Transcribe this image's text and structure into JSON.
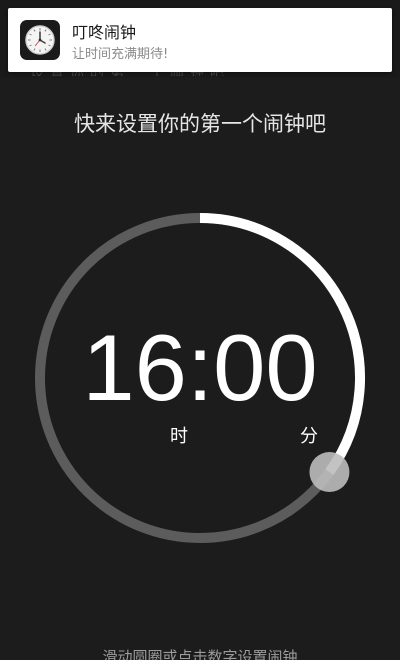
{
  "notification": {
    "app_icon": "clock-face-icon",
    "title": "叮咚闹钟",
    "body": "让时间充满期待!"
  },
  "background_text": "设置你的第一个闹钟吧",
  "heading": "快来设置你的第一个闹钟吧",
  "time": {
    "hours": "16",
    "separator": ":",
    "minutes": "00",
    "hour_label": "时",
    "minute_label": "分"
  },
  "dial": {
    "progress_fraction": 0.35,
    "track_color": "#5c5c5c",
    "progress_color": "#ffffff",
    "handle_color": "#bdbdbd",
    "handle_icon": "dial-handle-knob"
  },
  "hint": "滑动圆圈或点击数字设置闹钟",
  "colors": {
    "background": "#1c1c1c",
    "notification_bg": "#ffffff"
  }
}
